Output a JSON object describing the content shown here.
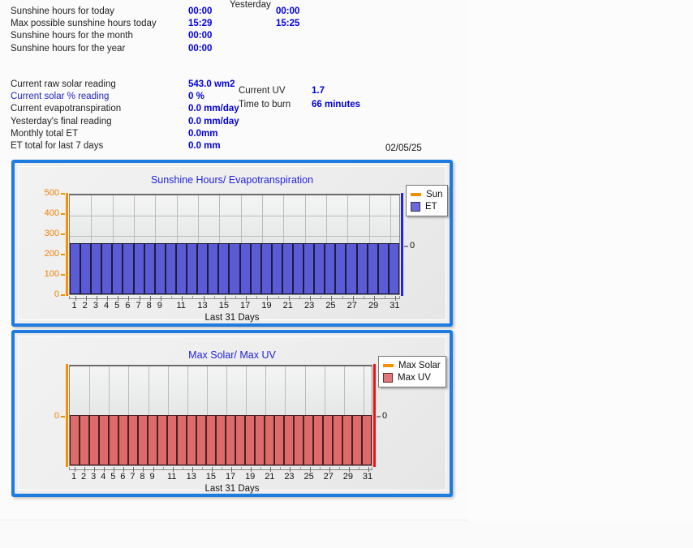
{
  "header": {
    "yesterday_label": "Yesterday"
  },
  "sunshine_rows": [
    {
      "label": "Sunshine hours for today",
      "today": "00:00",
      "yesterday": "00:00"
    },
    {
      "label": "Max possible sunshine hours today",
      "today": "15:29",
      "yesterday": "15:25"
    },
    {
      "label": "Sunshine hours for the month",
      "today": "00:00",
      "yesterday": ""
    },
    {
      "label": "Sunshine hours for the year",
      "today": "00:00",
      "yesterday": ""
    }
  ],
  "solar_rows": [
    {
      "label": "Current raw solar reading",
      "value": "543.0 wm2",
      "link": false
    },
    {
      "label": "Current solar % reading",
      "value": "0 %",
      "link": true
    },
    {
      "label": "Current evapotranspiration",
      "value": "0.0 mm/day",
      "link": false
    },
    {
      "label": "Yesterday's final reading",
      "value": "0.0 mm/day",
      "link": false
    },
    {
      "label": "Monthly total ET",
      "value": "0.0mm",
      "link": false
    },
    {
      "label": "ET total for last 7 days",
      "value": "0.0 mm",
      "link": false
    }
  ],
  "uv_rows": [
    {
      "label": "Current UV",
      "value": "1.7"
    },
    {
      "label": "Time to burn",
      "value": "66 minutes"
    }
  ],
  "date_stamp": "02/05/25",
  "chart_data": [
    {
      "type": "bar",
      "title": "Sunshine Hours/ Evapotranspiration",
      "xlabel": "Last 31 Days",
      "ylabel": "",
      "ylim": [
        0,
        500
      ],
      "yticks": [
        0,
        100,
        200,
        300,
        400,
        500
      ],
      "y2lim": [
        0,
        0
      ],
      "y2ticks": [
        0
      ],
      "grid": true,
      "legend_position": "right-top",
      "categories": [
        1,
        2,
        3,
        4,
        5,
        6,
        7,
        8,
        9,
        10,
        11,
        12,
        13,
        14,
        15,
        16,
        17,
        18,
        19,
        20,
        21,
        22,
        23,
        24,
        25,
        26,
        27,
        28,
        29,
        30,
        31
      ],
      "xtick_labels": [
        "1",
        "2",
        "3",
        "4",
        "5",
        "6",
        "7",
        "8",
        "9",
        "",
        "11",
        "",
        "13",
        "",
        "15",
        "",
        "17",
        "",
        "19",
        "",
        "21",
        "",
        "23",
        "",
        "25",
        "",
        "27",
        "",
        "29",
        "",
        "31"
      ],
      "series": [
        {
          "name": "Sun",
          "type": "line",
          "color": "#f59000",
          "axis": "right",
          "values": [
            0,
            0,
            0,
            0,
            0,
            0,
            0,
            0,
            0,
            0,
            0,
            0,
            0,
            0,
            0,
            0,
            0,
            0,
            0,
            0,
            0,
            0,
            0,
            0,
            0,
            0,
            0,
            0,
            0,
            0,
            0
          ]
        },
        {
          "name": "ET",
          "type": "bar",
          "color": "#5b5bd6",
          "axis": "left",
          "values": [
            250,
            250,
            250,
            250,
            250,
            250,
            250,
            250,
            250,
            250,
            250,
            250,
            250,
            250,
            250,
            250,
            250,
            250,
            250,
            250,
            250,
            250,
            250,
            250,
            250,
            250,
            250,
            250,
            250,
            250,
            250
          ]
        }
      ]
    },
    {
      "type": "bar",
      "title": "Max Solar/ Max UV",
      "xlabel": "Last 31 Days",
      "ylabel": "",
      "ylim": [
        0,
        0
      ],
      "yticks": [
        0
      ],
      "y2lim": [
        0,
        0
      ],
      "y2ticks": [
        0
      ],
      "grid": true,
      "legend_position": "right-top",
      "categories": [
        1,
        2,
        3,
        4,
        5,
        6,
        7,
        8,
        9,
        10,
        11,
        12,
        13,
        14,
        15,
        16,
        17,
        18,
        19,
        20,
        21,
        22,
        23,
        24,
        25,
        26,
        27,
        28,
        29,
        30,
        31
      ],
      "xtick_labels": [
        "1",
        "2",
        "3",
        "4",
        "5",
        "6",
        "7",
        "8",
        "9",
        "",
        "11",
        "",
        "13",
        "",
        "15",
        "",
        "17",
        "",
        "19",
        "",
        "21",
        "",
        "23",
        "",
        "25",
        "",
        "27",
        "",
        "29",
        "",
        "31"
      ],
      "series": [
        {
          "name": "Max Solar",
          "type": "line",
          "color": "#f59000",
          "axis": "left",
          "values": [
            0,
            0,
            0,
            0,
            0,
            0,
            0,
            0,
            0,
            0,
            0,
            0,
            0,
            0,
            0,
            0,
            0,
            0,
            0,
            0,
            0,
            0,
            0,
            0,
            0,
            0,
            0,
            0,
            0,
            0,
            0
          ]
        },
        {
          "name": "Max UV",
          "type": "bar",
          "color": "#de6b6b",
          "axis": "right",
          "values": [
            0,
            0,
            0,
            0,
            0,
            0,
            0,
            0,
            0,
            0,
            0,
            0,
            0,
            0,
            0,
            0,
            0,
            0,
            0,
            0,
            0,
            0,
            0,
            0,
            0,
            0,
            0,
            0,
            0,
            0,
            0
          ]
        }
      ]
    }
  ]
}
